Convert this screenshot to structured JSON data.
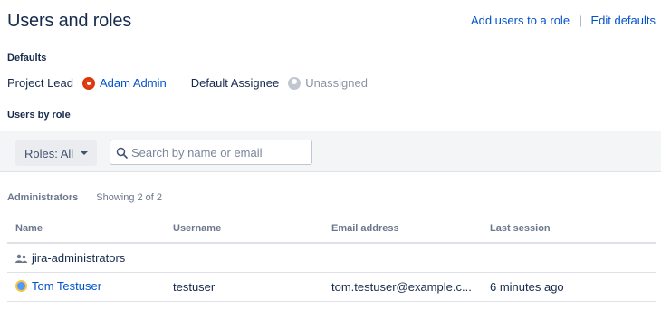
{
  "header": {
    "title": "Users and roles",
    "add_users_label": "Add users to a role",
    "separator": "|",
    "edit_defaults_label": "Edit defaults"
  },
  "defaults": {
    "section_label": "Defaults",
    "project_lead_label": "Project Lead",
    "project_lead_value": "Adam Admin",
    "default_assignee_label": "Default Assignee",
    "default_assignee_value": "Unassigned"
  },
  "users_by_role": {
    "section_label": "Users by role",
    "roles_filter_label": "Roles: All",
    "search_placeholder": "Search by name or email"
  },
  "group": {
    "title": "Administrators",
    "showing": "Showing 2 of 2"
  },
  "table": {
    "columns": [
      "Name",
      "Username",
      "Email address",
      "Last session"
    ],
    "rows": [
      {
        "type": "group",
        "name": "jira-administrators",
        "username": "",
        "email": "",
        "last_session": ""
      },
      {
        "type": "user",
        "name": "Tom Testuser",
        "username": "testuser",
        "email": "tom.testuser@example.c...",
        "last_session": "6 minutes ago"
      }
    ]
  },
  "colors": {
    "link": "#0052cc",
    "text": "#172b4d",
    "muted": "#6b778c",
    "toolbar_bg": "#f4f5f7"
  }
}
